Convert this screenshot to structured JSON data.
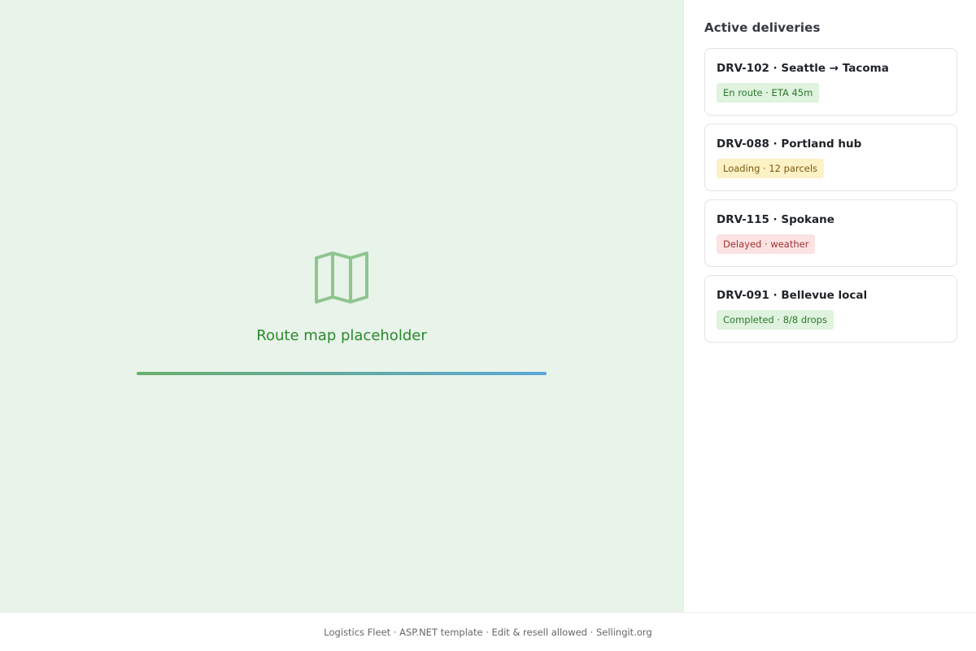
{
  "map": {
    "placeholder_label": "Route map placeholder",
    "icon": "map-icon",
    "colors": {
      "background": "#e8f3ea",
      "icon": "#8fc58f",
      "label": "#2a8a2a",
      "progress_start": "#6aae6a",
      "progress_end": "#5aa6d8"
    }
  },
  "sidebar": {
    "title": "Active deliveries",
    "deliveries": [
      {
        "title": "DRV-102 · Seattle → Tacoma",
        "status": "En route · ETA 45m",
        "tone": "success"
      },
      {
        "title": "DRV-088 · Portland hub",
        "status": "Loading · 12 parcels",
        "tone": "warning"
      },
      {
        "title": "DRV-115 · Spokane",
        "status": "Delayed · weather",
        "tone": "danger"
      },
      {
        "title": "DRV-091 · Bellevue local",
        "status": "Completed · 8/8 drops",
        "tone": "success"
      }
    ]
  },
  "footer": {
    "text": "Logistics Fleet · ASP.NET template · Edit & resell allowed · Sellingit.org"
  }
}
